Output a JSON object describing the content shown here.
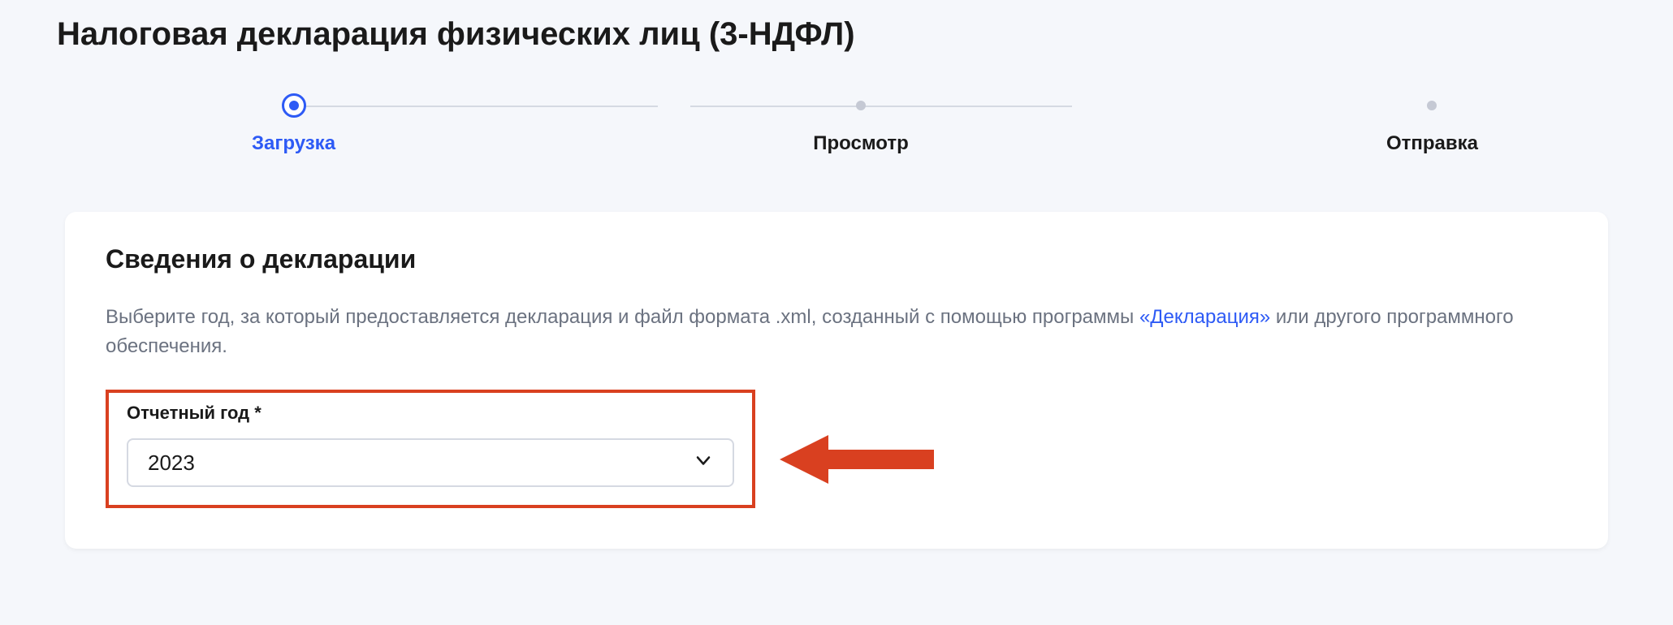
{
  "page_title": "Налоговая декларация физических лиц (3-НДФЛ)",
  "stepper": {
    "steps": [
      {
        "label": "Загрузка",
        "active": true
      },
      {
        "label": "Просмотр",
        "active": false
      },
      {
        "label": "Отправка",
        "active": false
      }
    ]
  },
  "card": {
    "title": "Сведения о декларации",
    "description_before_link": "Выберите год, за который предоставляется декларация и файл формата .xml, созданный с помощью программы ",
    "link_text": "«Декларация»",
    "description_after_link": " или другого программного обеспечения.",
    "field": {
      "label": "Отчетный год *",
      "value": "2023"
    }
  },
  "colors": {
    "accent": "#2d5af5",
    "annotation": "#d94020"
  }
}
